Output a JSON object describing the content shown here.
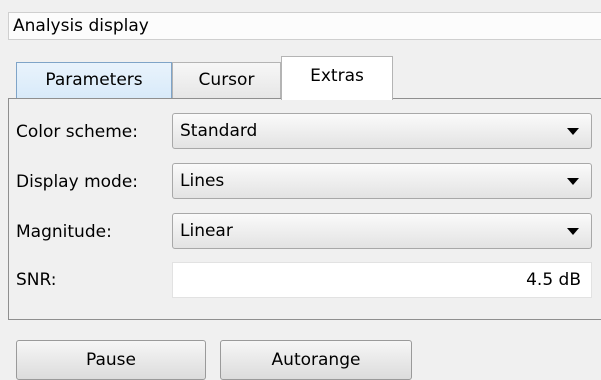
{
  "panel": {
    "title": "Analysis display"
  },
  "tabs": [
    {
      "label": "Parameters",
      "state": "hover"
    },
    {
      "label": "Cursor",
      "state": "normal"
    },
    {
      "label": "Extras",
      "state": "active"
    }
  ],
  "extras": {
    "color_scheme": {
      "label": "Color scheme:",
      "value": "Standard"
    },
    "display_mode": {
      "label": "Display mode:",
      "value": "Lines"
    },
    "magnitude": {
      "label": "Magnitude:",
      "value": "Linear"
    },
    "snr": {
      "label": "SNR:",
      "value": "4.5 dB"
    }
  },
  "buttons": {
    "pause": "Pause",
    "autorange": "Autorange"
  }
}
